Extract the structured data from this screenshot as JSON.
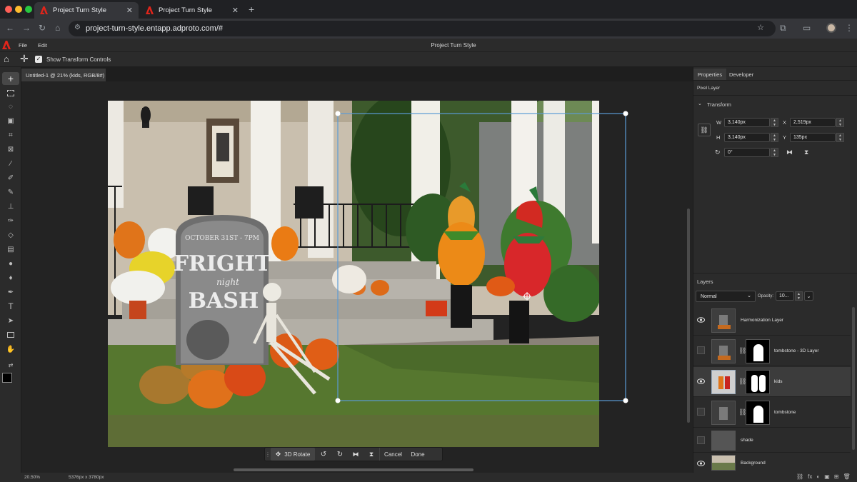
{
  "browser": {
    "tabs": [
      {
        "title": "Project Turn Style",
        "active": true
      },
      {
        "title": "Project Turn Style",
        "active": false
      }
    ],
    "url": "project-turn-style.entapp.adproto.com/#"
  },
  "app": {
    "title": "Project Turn Style",
    "menu": [
      "File",
      "Edit"
    ],
    "options": {
      "show_transform_label": "Show Transform Controls",
      "show_transform_checked": true
    }
  },
  "document": {
    "tab_label": "Untitled-1 @ 21% (kids, RGB/8#)",
    "zoom": "20.50%",
    "dimensions": "5376px x 3780px"
  },
  "canvas": {
    "tombstone_text": [
      "OCTOBER 31ST - 7PM",
      "FRIGHT",
      "night",
      "BASH"
    ]
  },
  "floating_bar": {
    "rotate_label": "3D Rotate",
    "cancel_label": "Cancel",
    "done_label": "Done"
  },
  "properties": {
    "tabs": [
      "Properties",
      "Developer"
    ],
    "layer_type": "Pixel Layer",
    "section": "Transform",
    "w_label": "W",
    "w_value": "3,140px",
    "x_label": "X",
    "x_value": "2,519px",
    "h_label": "H",
    "h_value": "3,140px",
    "y_label": "Y",
    "y_value": "135px",
    "angle_value": "0°"
  },
  "layers_panel": {
    "title": "Layers",
    "blend_mode": "Normal",
    "opacity_label": "Opacity:",
    "opacity_value": "10...",
    "layers": [
      {
        "name": "Harmonization Layer",
        "visible": true,
        "mask": false,
        "selected": false
      },
      {
        "name": "tombstone - 3D Layer",
        "visible": false,
        "mask": true,
        "selected": false
      },
      {
        "name": "kids",
        "visible": true,
        "mask": true,
        "selected": true
      },
      {
        "name": "tombstone",
        "visible": false,
        "mask": true,
        "selected": false
      },
      {
        "name": "shade",
        "visible": false,
        "mask": false,
        "selected": false
      },
      {
        "name": "Background",
        "visible": true,
        "mask": false,
        "selected": false
      }
    ]
  },
  "colors": {
    "accent": "#e1251b",
    "transform_box": "#5b9bd5"
  }
}
